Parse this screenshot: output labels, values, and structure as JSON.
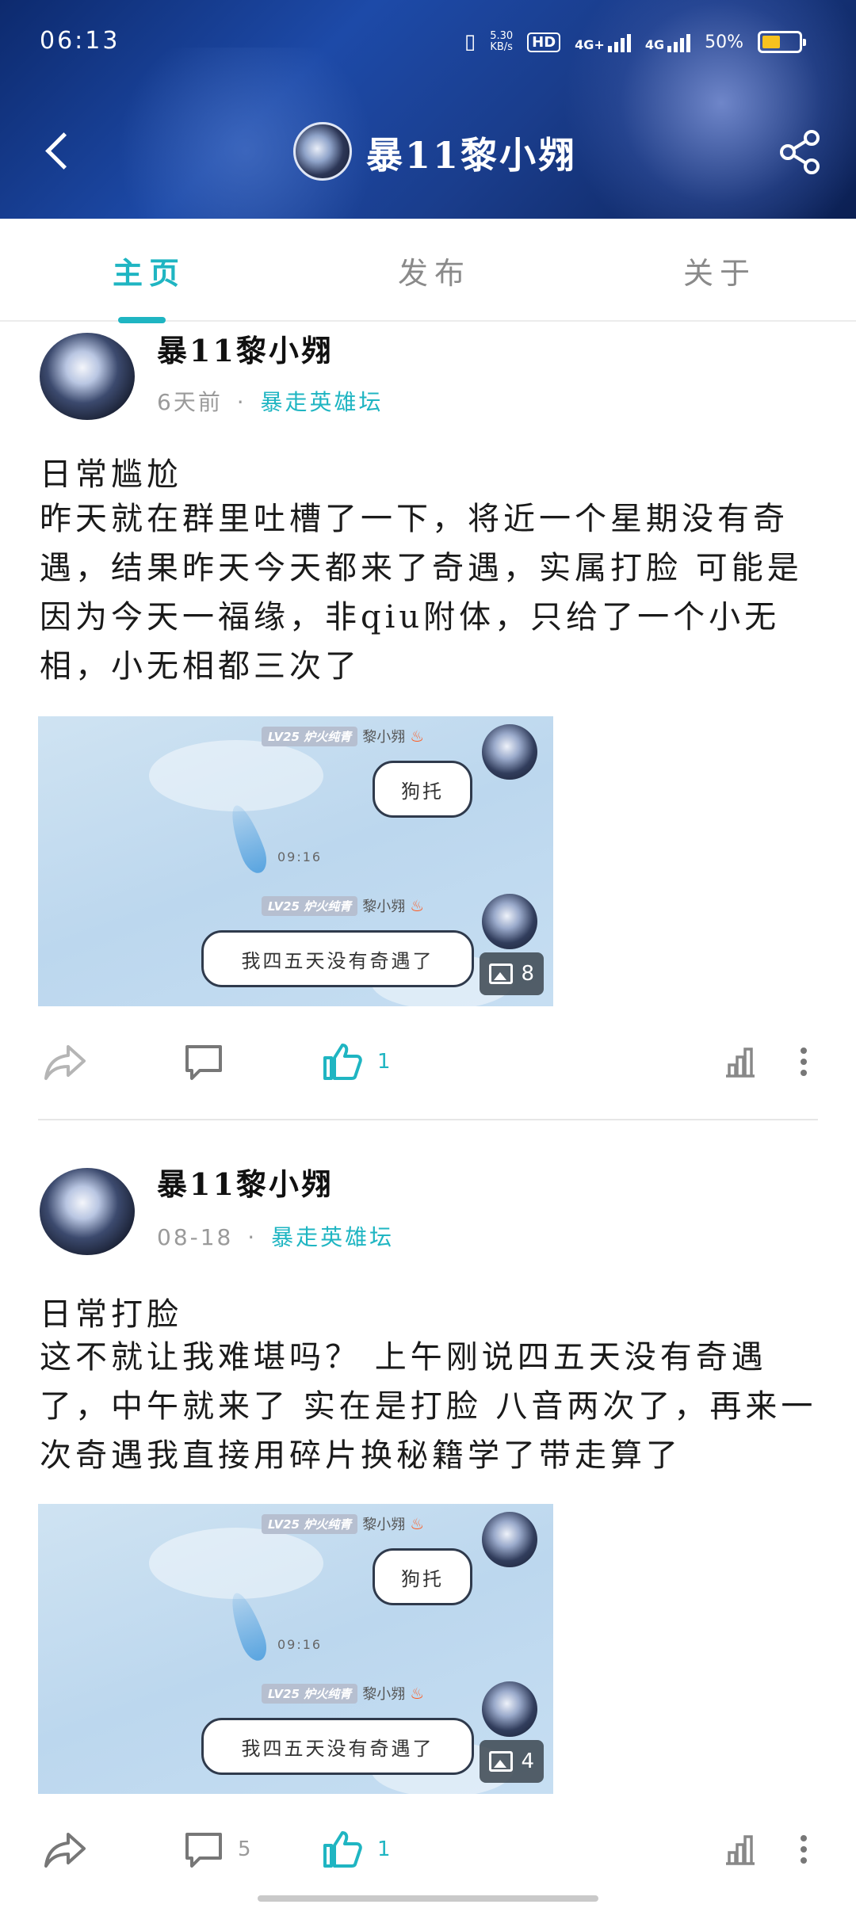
{
  "status_bar": {
    "time": "06:13",
    "net_speed_top": "5.30",
    "net_speed_unit": "KB/s",
    "hd": "HD",
    "sim1": "4G+",
    "sim2": "4G",
    "battery": "50%",
    "battery_level": 0.5
  },
  "header": {
    "title": "暴11黎小翙",
    "back_icon": "back-arrow-icon",
    "share_icon": "share-icon"
  },
  "tabs": [
    {
      "label": "主页",
      "active": true
    },
    {
      "label": "发布",
      "active": false
    },
    {
      "label": "关于",
      "active": false
    }
  ],
  "posts": [
    {
      "author": "暴11黎小翙",
      "time": "6天前",
      "separator": "·",
      "forum": "暴走英雄坛",
      "title": "日常尴尬",
      "body": "昨天就在群里吐槽了一下，将近一个星期没有奇遇，结果昨天今天都来了奇遇，实属打脸 可能是因为今天一福缘，非qiu附体，只给了一个小无相，小无相都三次了",
      "image": {
        "level_badge": "LV25 炉火纯青",
        "nick": "黎小翙",
        "msg1": "狗托",
        "timestamp": "09:16",
        "msg2": "我四五天没有奇遇了",
        "count": "8"
      },
      "comments": "",
      "likes": "1"
    },
    {
      "author": "暴11黎小翙",
      "time": "08-18",
      "separator": "·",
      "forum": "暴走英雄坛",
      "title": "日常打脸",
      "body": "这不就让我难堪吗？ 上午刚说四五天没有奇遇了，中午就来了 实在是打脸 八音两次了，再来一次奇遇我直接用碎片换秘籍学了带走算了",
      "image": {
        "level_badge": "LV25 炉火纯青",
        "nick": "黎小翙",
        "msg1": "狗托",
        "timestamp": "09:16",
        "msg2": "我四五天没有奇遇了",
        "count": "4"
      },
      "comments": "5",
      "likes": "1"
    }
  ],
  "colors": {
    "accent": "#1fb5c2",
    "header_bg": "#1a3d8c",
    "muted": "#9a9a9a"
  }
}
